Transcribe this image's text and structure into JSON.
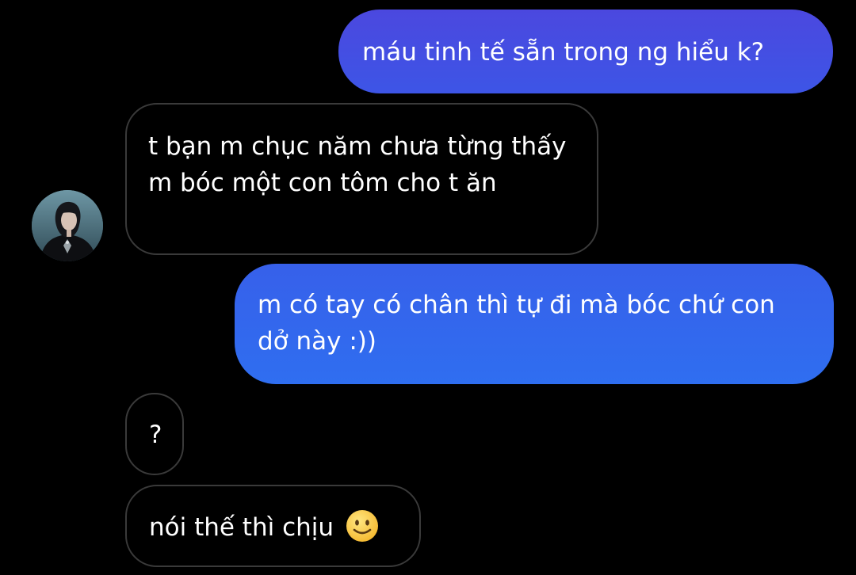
{
  "colors": {
    "background": "#000000",
    "outgoing_top": "#4a4ae0",
    "outgoing_bottom": "#2f6ff0",
    "incoming_border": "#3a3a3a",
    "text": "#ffffff"
  },
  "contact": {
    "avatar_icon": "profile-photo"
  },
  "messages": [
    {
      "id": "m1",
      "direction": "outgoing",
      "text": "máu tinh tế sẵn trong ng hiểu k?"
    },
    {
      "id": "m2",
      "direction": "incoming",
      "text": "t bạn m chục năm chưa từng thấy m bóc một con tôm cho t ăn"
    },
    {
      "id": "m3",
      "direction": "outgoing",
      "text": "m có tay có chân thì tự đi mà bóc chứ con dở này :))"
    },
    {
      "id": "m4",
      "direction": "incoming",
      "text": "?"
    },
    {
      "id": "m5",
      "direction": "incoming",
      "text": "nói thế thì chịu",
      "emoji": "slightly-smiling-face"
    }
  ]
}
